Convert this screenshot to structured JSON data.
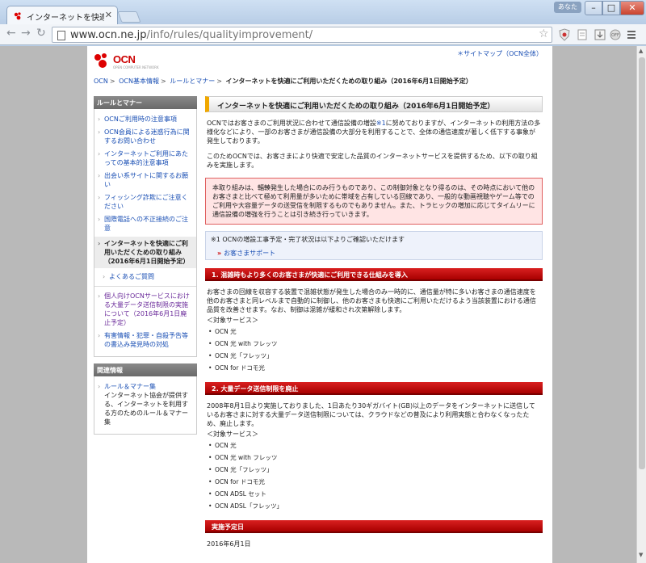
{
  "browser": {
    "tab_title": "インターネットを快適に",
    "url_host": "www.ocn.ne.jp",
    "url_path": "/info/rules/qualityimprovement/",
    "user_badge": "あなた"
  },
  "header": {
    "logo": "OCN",
    "logo_sub": "OPEN COMPUTER NETWORK",
    "sitemap": "＊サイトマップ（OCN全体）"
  },
  "breadcrumb": {
    "items": [
      "OCN",
      "OCN基本情報",
      "ルールとマナー"
    ],
    "current": "インターネットを快適にご利用いただくための取り組み（2016年6月1日開始予定）"
  },
  "sidebar": {
    "heading1": "ルールとマナー",
    "items": [
      "OCNご利用時の注意事項",
      "OCN会員による迷惑行為に関するお問い合わせ",
      "インターネットご利用にあたっての基本的注意事項",
      "出会い系サイトに関するお願い",
      "フィッシング詐欺にご注意ください",
      "国際電話への不正接続のご注意"
    ],
    "active_item": "インターネットを快適にご利用いただくための取り組み（2016年6月1日開始予定）",
    "sub_item": "よくあるご質問",
    "items_after": [
      "個人向けOCNサービスにおける大量データ送信制限の実施について（2016年6月1日廃止予定）",
      "有害情報・犯罪・自殺予告等の書込み発見時の対処"
    ],
    "heading2": "関連情報",
    "related_link": "ルール＆マナー集",
    "related_desc": "インターネット協会が提供する、インターネットを利用する方のためのルール＆マナー集"
  },
  "main": {
    "title": "インターネットを快適にご利用いただくための取り組み（2016年6月1日開始予定）",
    "intro1_a": "OCNではお客さまのご利用状況に合わせて通信設備の増設",
    "intro1_ref": "※1",
    "intro1_b": "に努めておりますが、インターネットの利用方法の多様化などにより、一部のお客さまが通信設備の大部分を利用することで、全体の通信速度が著しく低下する事象が発生しております。",
    "intro2": "このためOCNでは、お客さまにより快適で安定した品質のインターネットサービスを提供するため、以下の取り組みを実施します。",
    "alert": "本取り組みは、輻輳発生した場合にのみ行うものであり、この制御対象となり得るのは、その時点において他のお客さまと比べて極めて利用量が多いために帯域を占有している回線であり、一般的な動画視聴やゲーム等でのご利用や大容量データの送受信を制限するものでもありません。また、トラヒックの増加に応じてタイムリーに通信設備の増強を行うことは引き続き行っていきます。",
    "note_text": "※1 OCNの増設工事予定・完了状況は以下よりご確認いただけます",
    "note_link": "お客さまサポート",
    "section1_title": "1. 混雑時もより多くのお客さまが快適にご利用できる仕組みを導入",
    "section1_body": "お客さまの回線を収容する装置で混雑状態が発生した場合のみ一時的に、通信量が特に多いお客さまの通信速度を他のお客さまと同レベルまで自動的に制御し、他のお客さまも快適にご利用いただけるよう当該装置における通信品質を改善させます。なお、制御は混雑が緩和され次第解除します。",
    "services_label": "＜対象サービス＞",
    "section1_services": [
      "OCN 光",
      "OCN 光 with フレッツ",
      "OCN 光「フレッツ」",
      "OCN for ドコモ光"
    ],
    "section2_title": "2. 大量データ送信制限を廃止",
    "section2_body": "2008年8月1日より実施しておりました、1日あたり30ギガバイト(GB)以上のデータをインターネットに送信しているお客さまに対する大量データ送信制限については、クラウドなどの普及により利用実態と合わなくなったため、廃止します。",
    "section2_services": [
      "OCN 光",
      "OCN 光 with フレッツ",
      "OCN 光「フレッツ」",
      "OCN for ドコモ光",
      "OCN ADSL セット",
      "OCN ADSL「フレッツ」"
    ],
    "section3_title": "実施予定日",
    "date": "2016年6月1日"
  }
}
